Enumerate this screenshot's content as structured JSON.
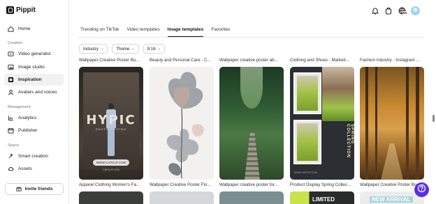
{
  "app": {
    "logo_text": "Pippit"
  },
  "sidebar": {
    "items_top": [
      {
        "label": "Home",
        "icon": "home-icon"
      }
    ],
    "creation_label": "Creation",
    "creation_items": [
      {
        "label": "Video generator",
        "icon": "video-icon"
      },
      {
        "label": "Image studio",
        "icon": "image-icon"
      },
      {
        "label": "Inspiration",
        "icon": "inspiration-icon",
        "active": true
      },
      {
        "label": "Avatars and voices",
        "icon": "avatar-icon"
      }
    ],
    "management_label": "Management",
    "management_items": [
      {
        "label": "Analytics",
        "icon": "analytics-icon"
      },
      {
        "label": "Publisher",
        "icon": "calendar-icon"
      }
    ],
    "space_label": "Space",
    "space_items": [
      {
        "label": "Smart creation",
        "icon": "smart-creation-icon"
      },
      {
        "label": "Assets",
        "icon": "cloud-icon"
      }
    ],
    "invite_label": "Invite friends"
  },
  "topbar": {
    "language_badge": "EN"
  },
  "tabs": [
    {
      "label": "Trending on TikTok"
    },
    {
      "label": "Video templates"
    },
    {
      "label": "Image templates",
      "active": true
    },
    {
      "label": "Favorites"
    }
  ],
  "filters": [
    {
      "label": "Industry"
    },
    {
      "label": "Theme"
    },
    {
      "label": "9:16"
    }
  ],
  "cards": [
    {
      "title": "Wallpaper Creative Poster Bu...",
      "caption": "Apparel Clothing Women's Fa...",
      "overlay_title": "HYPIC",
      "overlay_sub": "PHOTO EDITING",
      "overlay_web": "WWW.CAPCUT.COM",
      "overlay_tag": "CAPCUT.COM"
    },
    {
      "title": "Beauty and Personal Care - C...",
      "caption": "Wallpaper Creative Poster Flo..."
    },
    {
      "title": "Wallpaper creative poster ab...",
      "caption": "Wallpaper creative poster for..."
    },
    {
      "title": "Clothing and Shoes - Marketi...",
      "caption": "Product Display Spring Collec...",
      "overlay_vertical": "SPRING COLLECTION",
      "overlay_small": "WWW.CAPCUT.COM"
    },
    {
      "title": "Fashion Industry - Instagram ...",
      "caption": "Wallpaper Creative Poster Bu..."
    }
  ],
  "next_row": {
    "limited_text": "LIMITED",
    "new_arrival_text": "NEW ARRIVAL"
  },
  "colors": {
    "accent": "#5b2ee6",
    "text": "#222222",
    "border": "#d8d8d8"
  }
}
